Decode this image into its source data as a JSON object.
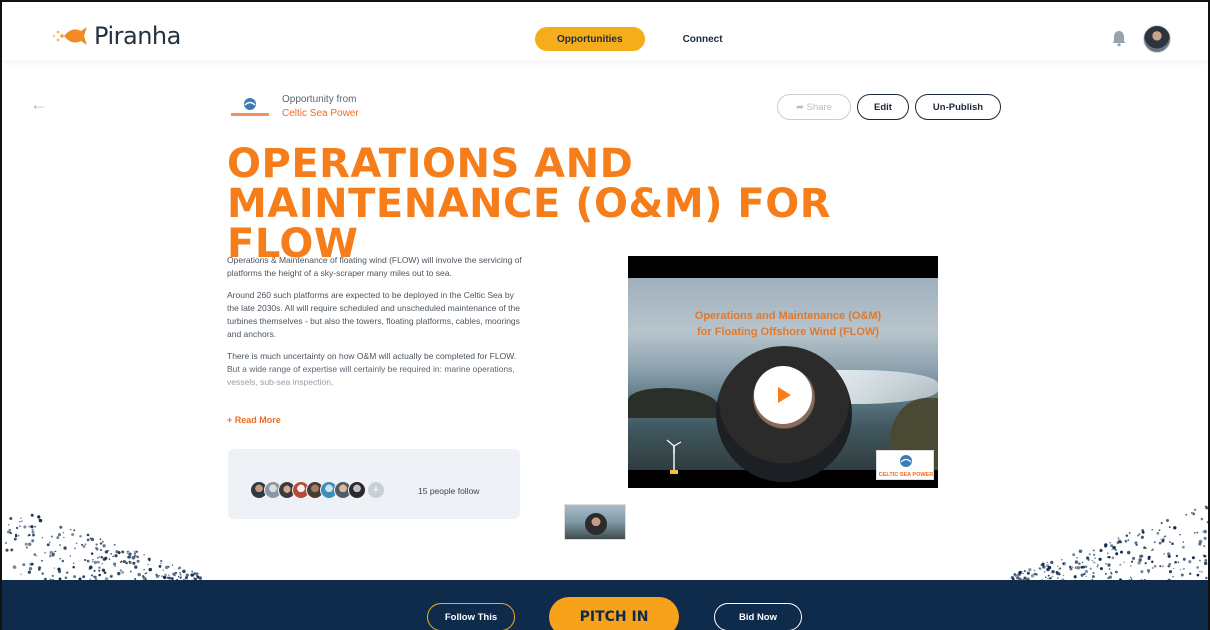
{
  "nav": {
    "brand": "Piranha",
    "tabs": [
      {
        "label": "Opportunities",
        "active": true
      },
      {
        "label": "Connect",
        "active": false
      }
    ],
    "icons": {
      "notifications": "bell-icon",
      "profile": "user-avatar"
    }
  },
  "header": {
    "opportunity_from": "Opportunity from",
    "org_name": "Celtic Sea Power",
    "org_logo_text": "CELTIC SEA POWER",
    "actions": {
      "share": "Share",
      "edit": "Edit",
      "unpublish": "Un-Publish"
    }
  },
  "title": "OPERATIONS AND MAINTENANCE (O&M) FOR FLOW",
  "description": {
    "paragraphs": [
      "Operations & Maintenance of floating wind (FLOW) will involve the servicing of platforms the height of a sky-scraper many miles out to sea.",
      "Around 260 such platforms are expected to be deployed in the Celtic Sea by the late 2030s. All will require scheduled and unscheduled maintenance of the turbines themselves - but also the towers,  floating platforms, cables, moorings and anchors.",
      "There is much uncertainty on how O&M will actually be completed for FLOW. But a wide range of expertise will certainly be required in: marine operations, vessels, sub-sea inspection,"
    ],
    "read_more": "+ Read More"
  },
  "followers": {
    "count_text": "15 people follow",
    "plus": "+"
  },
  "video": {
    "caption_line1": "Operations and Maintenance (O&M)",
    "caption_line2": "for Floating Offshore Wind (FLOW)",
    "badge_text": "CELTIC SEA POWER"
  },
  "bottom_bar": {
    "follow": "Follow This",
    "pitch": "PITCH IN",
    "bid": "Bid Now"
  },
  "colors": {
    "accent_orange": "#f57e1b",
    "nav_yellow": "#f5ad1b",
    "navy": "#0f2b4c"
  }
}
